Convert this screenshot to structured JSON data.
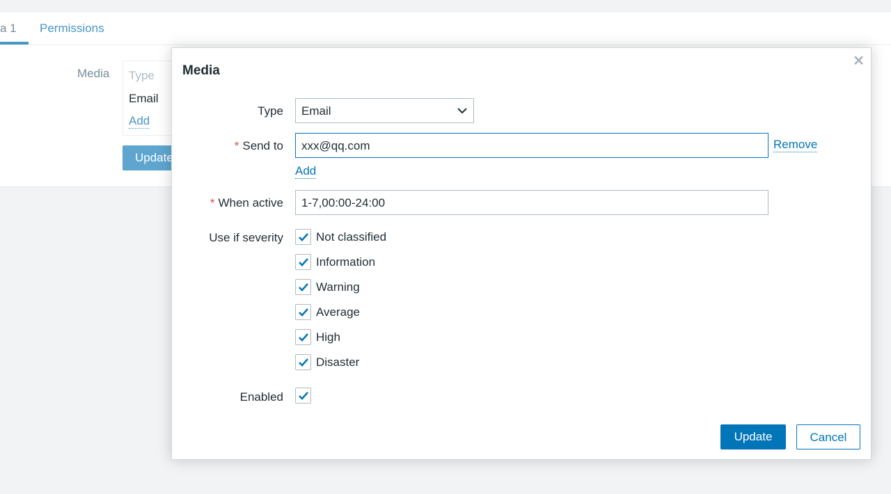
{
  "background": {
    "tabs": [
      {
        "label": "a 1",
        "active": true
      },
      {
        "label": "Permissions",
        "active": false
      }
    ],
    "media_label": "Media",
    "table_header": "Type",
    "table_row": "Email",
    "add_link": "Add",
    "update_button": "Update"
  },
  "modal": {
    "title": "Media",
    "close_icon": "close-icon",
    "type": {
      "label": "Type",
      "value": "Email"
    },
    "send_to": {
      "label": "Send to",
      "value": "xxx@qq.com",
      "remove": "Remove",
      "add": "Add"
    },
    "when_active": {
      "label": "When active",
      "value": "1-7,00:00-24:00"
    },
    "severity": {
      "label": "Use if severity",
      "items": [
        {
          "label": "Not classified",
          "checked": true
        },
        {
          "label": "Information",
          "checked": true
        },
        {
          "label": "Warning",
          "checked": true
        },
        {
          "label": "Average",
          "checked": true
        },
        {
          "label": "High",
          "checked": true
        },
        {
          "label": "Disaster",
          "checked": true
        }
      ]
    },
    "enabled": {
      "label": "Enabled",
      "checked": true
    },
    "update_button": "Update",
    "cancel_button": "Cancel",
    "accent": "#0275b8",
    "required_color": "#d64e4e"
  }
}
